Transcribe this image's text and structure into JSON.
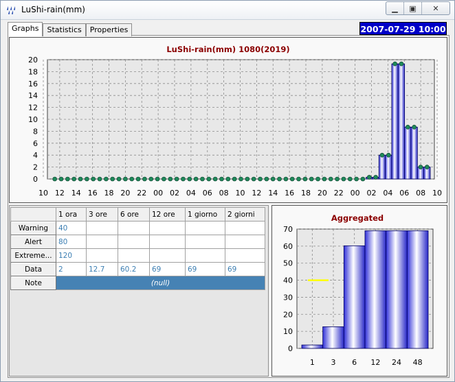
{
  "window": {
    "title": "LuShi-rain(mm)",
    "minimize_icon": "minimize-icon",
    "maximize_icon": "maximize-icon",
    "close_icon": "close-icon"
  },
  "tabs": [
    {
      "label": "Graphs",
      "active": true
    },
    {
      "label": "Statistics",
      "active": false
    },
    {
      "label": "Properties",
      "active": false
    }
  ],
  "datetime": "2007-07-29 10:00",
  "colors": {
    "title_red": "#8b0000",
    "bar_blue": "#4040e0",
    "marker_green": "#1f8a5a",
    "datetime_bg": "#0000c8",
    "null_bg": "#4682b4",
    "warning_line": "#ffff00"
  },
  "chart_data": [
    {
      "type": "bar",
      "title": "LuShi-rain(mm)  1080(2019)",
      "ylim": [
        0,
        20
      ],
      "yticks": [
        "0",
        "2",
        "4",
        "6",
        "8",
        "10",
        "12",
        "14",
        "16",
        "18",
        "20"
      ],
      "xtick_labels": [
        "10",
        "12",
        "14",
        "16",
        "18",
        "20",
        "22",
        "00",
        "02",
        "04",
        "06",
        "08",
        "10",
        "12",
        "14",
        "16",
        "18",
        "20",
        "22",
        "00",
        "02",
        "04",
        "06",
        "08",
        "10"
      ],
      "grid": true,
      "values": [
        0,
        0,
        0,
        0,
        0,
        0,
        0,
        0,
        0,
        0,
        0,
        0,
        0,
        0,
        0,
        0,
        0,
        0,
        0,
        0,
        0,
        0,
        0,
        0,
        0,
        0,
        0,
        0,
        0,
        0,
        0,
        0,
        0,
        0,
        0,
        0,
        0,
        0,
        0,
        0,
        0,
        0,
        0,
        0,
        0,
        0,
        0,
        0,
        0,
        0.3,
        0.3,
        4,
        4,
        19.3,
        19.3,
        8.7,
        8.7,
        2,
        2
      ]
    },
    {
      "type": "bar",
      "title": "Aggregated",
      "ylim": [
        0,
        70
      ],
      "yticks": [
        "0",
        "10",
        "20",
        "30",
        "40",
        "50",
        "60",
        "70"
      ],
      "categories": [
        "1",
        "3",
        "6",
        "12",
        "24",
        "48"
      ],
      "values": [
        2,
        12.7,
        60.2,
        69,
        69,
        69
      ],
      "warning_level": 40,
      "grid": true
    }
  ],
  "table": {
    "columns": [
      "1 ora",
      "3 ore",
      "6 ore",
      "12 ore",
      "1 giorno",
      "2 giorni"
    ],
    "rows": [
      {
        "label": "Warning",
        "cells": [
          "40",
          "",
          "",
          "",
          "",
          ""
        ]
      },
      {
        "label": "Alert",
        "cells": [
          "80",
          "",
          "",
          "",
          "",
          ""
        ]
      },
      {
        "label": "Extreme...",
        "cells": [
          "120",
          "",
          "",
          "",
          "",
          ""
        ]
      },
      {
        "label": "Data",
        "cells": [
          "2",
          "12.7",
          "60.2",
          "69",
          "69",
          "69"
        ]
      }
    ],
    "note": {
      "label": "Note",
      "value": "(null)"
    }
  }
}
